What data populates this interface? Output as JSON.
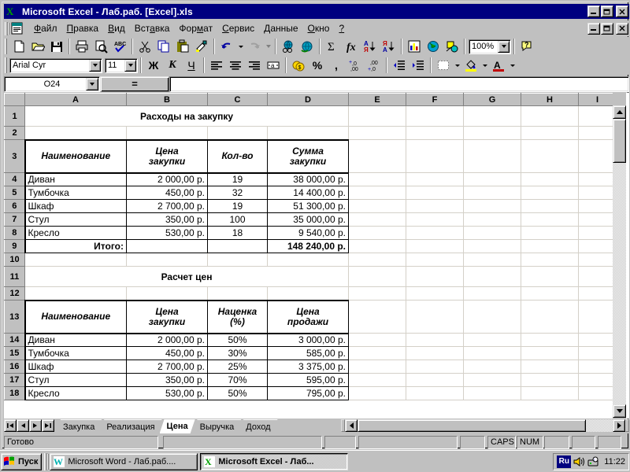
{
  "window": {
    "title": "Microsoft Excel - Лаб.раб. [Excel].xls",
    "app_icon": "excel-x-icon",
    "minimize_label": "_",
    "restore_label": "❐",
    "close_label": "✕"
  },
  "menubar": {
    "items": [
      {
        "label": "Файл",
        "accel": "Ф"
      },
      {
        "label": "Правка",
        "accel": "П"
      },
      {
        "label": "Вид",
        "accel": "В"
      },
      {
        "label": "Вставка",
        "accel": "а"
      },
      {
        "label": "Формат",
        "accel": "м"
      },
      {
        "label": "Сервис",
        "accel": "С"
      },
      {
        "label": "Данные",
        "accel": "Д"
      },
      {
        "label": "Окно",
        "accel": "О"
      },
      {
        "label": "?",
        "accel": "?"
      }
    ]
  },
  "standard_toolbar": {
    "buttons": [
      "new-document-icon",
      "open-folder-icon",
      "save-disk-icon",
      "print-icon",
      "print-preview-icon",
      "spellcheck-icon",
      "cut-scissors-icon",
      "copy-icon",
      "paste-clipboard-icon",
      "format-painter-icon",
      "undo-icon",
      "undo-dropdown-icon",
      "redo-icon",
      "redo-dropdown-icon",
      "insert-hyperlink-icon",
      "web-toolbar-icon",
      "autosum-icon",
      "paste-function-icon",
      "sort-ascending-icon",
      "sort-descending-icon",
      "chart-wizard-icon",
      "map-icon",
      "drawing-icon",
      "zoom-combo",
      "help-icon"
    ],
    "zoom_value": "100%"
  },
  "formatting_toolbar": {
    "font_name": "Arial Cyr",
    "font_size": "11",
    "buttons": [
      "bold-icon",
      "italic-icon",
      "underline-icon",
      "align-left-icon",
      "align-center-icon",
      "align-right-icon",
      "merge-center-icon",
      "currency-icon",
      "percent-icon",
      "comma-icon",
      "increase-decimal-icon",
      "decrease-decimal-icon",
      "decrease-indent-icon",
      "increase-indent-icon",
      "borders-icon",
      "fill-color-icon",
      "font-color-icon"
    ],
    "bold_label": "Ж",
    "italic_label": "К",
    "underline_label": "Ч",
    "percent_label": "%",
    "comma_label": ",",
    "font_color_label": "A"
  },
  "formula_bar": {
    "name_box_value": "O24",
    "equals_label": "=",
    "formula_value": ""
  },
  "sheet": {
    "column_headers": [
      "A",
      "B",
      "C",
      "D",
      "E",
      "F",
      "G",
      "H",
      "I"
    ],
    "row_headers": [
      "1",
      "2",
      "3",
      "4",
      "5",
      "6",
      "7",
      "8",
      "9",
      "10",
      "11",
      "12",
      "13",
      "14",
      "15",
      "16",
      "17",
      "18"
    ],
    "table1": {
      "title": "Расходы на закупку",
      "headers": [
        "Наименование",
        "Цена закупки",
        "Кол-во",
        "Сумма закупки"
      ],
      "header_lines": [
        [
          "Наименование"
        ],
        [
          "Цена",
          "закупки"
        ],
        [
          "Кол-во"
        ],
        [
          "Сумма",
          "закупки"
        ]
      ],
      "rows": [
        {
          "name": "Диван",
          "price": "2 000,00 р.",
          "qty": "19",
          "sum": "38 000,00 р."
        },
        {
          "name": "Тумбочка",
          "price": "450,00 р.",
          "qty": "32",
          "sum": "14 400,00 р."
        },
        {
          "name": "Шкаф",
          "price": "2 700,00 р.",
          "qty": "19",
          "sum": "51 300,00 р."
        },
        {
          "name": "Стул",
          "price": "350,00 р.",
          "qty": "100",
          "sum": "35 000,00 р."
        },
        {
          "name": "Кресло",
          "price": "530,00 р.",
          "qty": "18",
          "sum": "9 540,00 р."
        }
      ],
      "total_label": "Итого:",
      "total_value": "148 240,00 р."
    },
    "table2": {
      "title": "Расчет цен",
      "headers": [
        "Наименование",
        "Цена закупки",
        "Наценка (%)",
        "Цена продажи"
      ],
      "header_lines": [
        [
          "Наименование"
        ],
        [
          "Цена",
          "закупки"
        ],
        [
          "Наценка",
          "(%)"
        ],
        [
          "Цена",
          "продажи"
        ]
      ],
      "rows": [
        {
          "name": "Диван",
          "price": "2 000,00 р.",
          "markup": "50%",
          "sale": "3 000,00 р."
        },
        {
          "name": "Тумбочка",
          "price": "450,00 р.",
          "markup": "30%",
          "sale": "585,00 р."
        },
        {
          "name": "Шкаф",
          "price": "2 700,00 р.",
          "markup": "25%",
          "sale": "3 375,00 р."
        },
        {
          "name": "Стул",
          "price": "350,00 р.",
          "markup": "70%",
          "sale": "595,00 р."
        },
        {
          "name": "Кресло",
          "price": "530,00 р.",
          "markup": "50%",
          "sale": "795,00 р."
        }
      ]
    }
  },
  "tabs": {
    "items": [
      {
        "label": "Закупка",
        "active": false
      },
      {
        "label": "Реализация",
        "active": false
      },
      {
        "label": "Цена",
        "active": true
      },
      {
        "label": "Выручка",
        "active": false
      },
      {
        "label": "Доход",
        "active": false
      }
    ],
    "nav_first": "first-sheet-icon",
    "nav_prev": "prev-sheet-icon",
    "nav_next": "next-sheet-icon",
    "nav_last": "last-sheet-icon"
  },
  "statusbar": {
    "message": "Готово",
    "caps_label": "CAPS",
    "num_label": "NUM"
  },
  "taskbar": {
    "start_label": "Пуск",
    "start_icon": "windows-flag-icon",
    "tasks": [
      {
        "label": "Microsoft Word - Лаб.раб....",
        "icon": "word-w-icon",
        "active": false
      },
      {
        "label": "Microsoft Excel - Лаб...",
        "icon": "excel-x-icon",
        "active": true
      }
    ],
    "tray": {
      "language": "Ru",
      "icons": [
        "speaker-icon",
        "modem-icon"
      ],
      "clock": "11:22"
    }
  },
  "colors": {
    "desktop": "#c0c0c0",
    "titlebar": "#000080",
    "face": "#c0c0c0",
    "grid_line": "#d4d0c8"
  }
}
